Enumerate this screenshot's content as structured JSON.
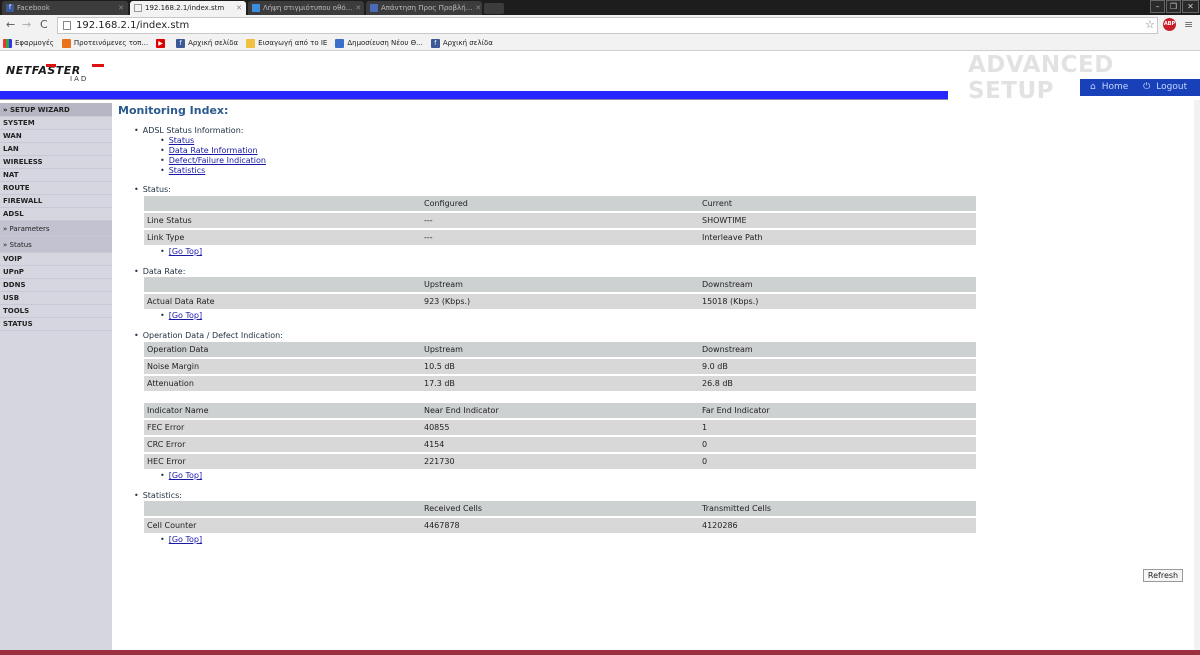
{
  "browser": {
    "tabs": [
      {
        "label": "Facebook",
        "active": false
      },
      {
        "label": "192.168.2.1/index.stm",
        "active": true
      },
      {
        "label": "Λήψη στιγμιότυπου οθό...",
        "active": false
      },
      {
        "label": "Απάντηση Προς Προβλή...",
        "active": false
      }
    ],
    "url": "192.168.2.1/index.stm",
    "bookmarks": [
      "Εφαρμογές",
      "Προτεινόμενες τοπ...",
      "",
      "Αρχική σελίδα",
      "Εισαγωγή από το IE",
      "Δημοσίευση Νέου Θ...",
      "Αρχική σελίδα"
    ],
    "abp_label": "ABP"
  },
  "header": {
    "logo_text": "NETFASTER",
    "logo_sub": "IAD",
    "banner": "ADVANCED SETUP",
    "home": "Home",
    "logout": "Logout"
  },
  "sidebar": {
    "items": [
      "» SETUP WIZARD",
      "SYSTEM",
      "WAN",
      "LAN",
      "WIRELESS",
      "NAT",
      "ROUTE",
      "FIREWALL",
      "ADSL",
      "» Parameters",
      "» Status",
      "VOIP",
      "UPnP",
      "DDNS",
      "USB",
      "TOOLS",
      "STATUS"
    ]
  },
  "main": {
    "title": "Monitoring Index:",
    "adsl_info_label": "ADSL Status Information:",
    "adsl_links": [
      "Status",
      "Data Rate Information",
      "Defect/Failure Indication",
      "Statistics"
    ],
    "go_top": "[Go Top]",
    "status": {
      "label": "Status:",
      "header": [
        "",
        "Configured",
        "Current"
      ],
      "rows": [
        [
          "Line Status",
          "---",
          "SHOWTIME"
        ],
        [
          "Link Type",
          "---",
          "Interleave Path"
        ]
      ]
    },
    "data_rate": {
      "label": "Data Rate:",
      "header": [
        "",
        "Upstream",
        "Downstream"
      ],
      "rows": [
        [
          "Actual Data Rate",
          "923 (Kbps.)",
          "15018 (Kbps.)"
        ]
      ]
    },
    "operation": {
      "label": "Operation Data / Defect Indication:",
      "header": [
        "Operation Data",
        "Upstream",
        "Downstream"
      ],
      "rows": [
        [
          "Noise Margin",
          "10.5 dB",
          "9.0 dB"
        ],
        [
          "Attenuation",
          "17.3 dB",
          "26.8 dB"
        ]
      ],
      "header2": [
        "Indicator Name",
        "Near End Indicator",
        "Far End Indicator"
      ],
      "rows2": [
        [
          "FEC Error",
          "40855",
          "1"
        ],
        [
          "CRC Error",
          "4154",
          "0"
        ],
        [
          "HEC Error",
          "221730",
          "0"
        ]
      ]
    },
    "statistics": {
      "label": "Statistics:",
      "header": [
        "",
        "Received Cells",
        "Transmitted Cells"
      ],
      "rows": [
        [
          "Cell Counter",
          "4467878",
          "4120286"
        ]
      ]
    },
    "refresh": "Refresh"
  }
}
